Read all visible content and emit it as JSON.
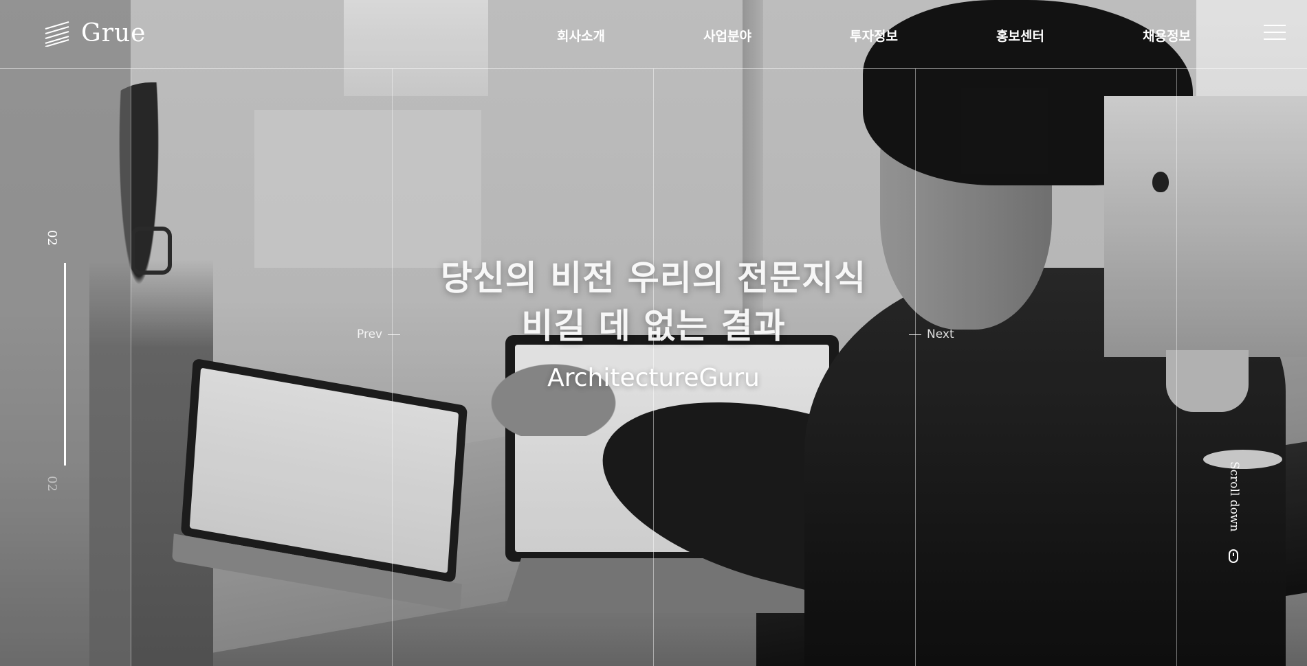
{
  "header": {
    "logo_text": "Grue",
    "nav": [
      "회사소개",
      "사업분야",
      "투자정보",
      "홍보센터",
      "채용정보"
    ]
  },
  "pager": {
    "current": "02",
    "total": "02"
  },
  "hero": {
    "title_line1": "당신의 비전 우리의 전문지식",
    "title_line2": "비길 데 없는 결과",
    "subtitle": "ArchitectureGuru"
  },
  "controls": {
    "prev": "Prev",
    "next": "Next",
    "scroll": "Scroll down"
  },
  "icons": {
    "logo": "stacked-lines-logo-icon",
    "menu": "hamburger-menu-icon",
    "scroll": "mouse-icon"
  }
}
